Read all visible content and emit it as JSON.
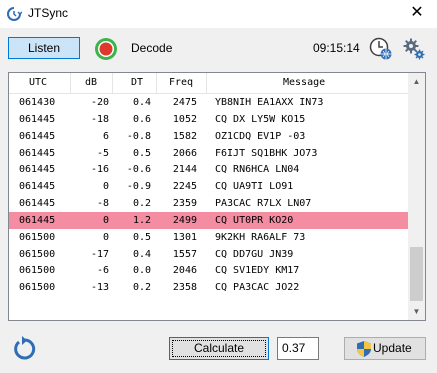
{
  "window": {
    "title": "JTSync",
    "close_glyph": "✕"
  },
  "toolbar": {
    "listen_label": "Listen",
    "record_icon": "record-icon",
    "decode_label": "Decode",
    "clock": "09:15:14",
    "globe_icon": "globe-clock-icon",
    "settings_icon": "gear-icon"
  },
  "table": {
    "columns": [
      "UTC",
      "dB",
      "DT",
      "Freq",
      "Message"
    ],
    "rows": [
      {
        "utc": "061430",
        "db": "-20",
        "dt": "0.4",
        "freq": "2475",
        "msg": "YB8NIH EA1AXX IN73"
      },
      {
        "utc": "061445",
        "db": "-18",
        "dt": "0.6",
        "freq": "1052",
        "msg": "CQ DX LY5W KO15"
      },
      {
        "utc": "061445",
        "db": "6",
        "dt": "-0.8",
        "freq": "1582",
        "msg": "OZ1CDQ EV1P -03"
      },
      {
        "utc": "061445",
        "db": "-5",
        "dt": "0.5",
        "freq": "2066",
        "msg": "F6IJT SQ1BHK JO73"
      },
      {
        "utc": "061445",
        "db": "-16",
        "dt": "-0.6",
        "freq": "2144",
        "msg": "CQ RN6HCA LN04"
      },
      {
        "utc": "061445",
        "db": "0",
        "dt": "-0.9",
        "freq": "2245",
        "msg": "CQ UA9TI LO91"
      },
      {
        "utc": "061445",
        "db": "-8",
        "dt": "0.2",
        "freq": "2359",
        "msg": "PA3CAC R7LX LN07"
      },
      {
        "utc": "061445",
        "db": "0",
        "dt": "1.2",
        "freq": "2499",
        "msg": "CQ UT0PR KO20"
      },
      {
        "utc": "061500",
        "db": "0",
        "dt": "0.5",
        "freq": "1301",
        "msg": "9K2KH RA6ALF 73"
      },
      {
        "utc": "061500",
        "db": "-17",
        "dt": "0.4",
        "freq": "1557",
        "msg": "CQ DD7GU JN39"
      },
      {
        "utc": "061500",
        "db": "-6",
        "dt": "0.0",
        "freq": "2046",
        "msg": "CQ SV1EDY KM17"
      },
      {
        "utc": "061500",
        "db": "-13",
        "dt": "0.2",
        "freq": "2358",
        "msg": "CQ PA3CAC JO22"
      }
    ],
    "selected_index": 7,
    "selected_color": "#f48ca2"
  },
  "footer": {
    "refresh_icon": "refresh-icon",
    "calculate_label": "Calculate",
    "value": "0.37",
    "update_label": "Update",
    "shield_icon": "shield-icon"
  },
  "colors": {
    "accent": "#0078d7",
    "listen_bg": "#cce4f7",
    "record_red": "#e0382e",
    "record_green": "#3ab54a",
    "refresh_blue": "#2f6db5"
  }
}
